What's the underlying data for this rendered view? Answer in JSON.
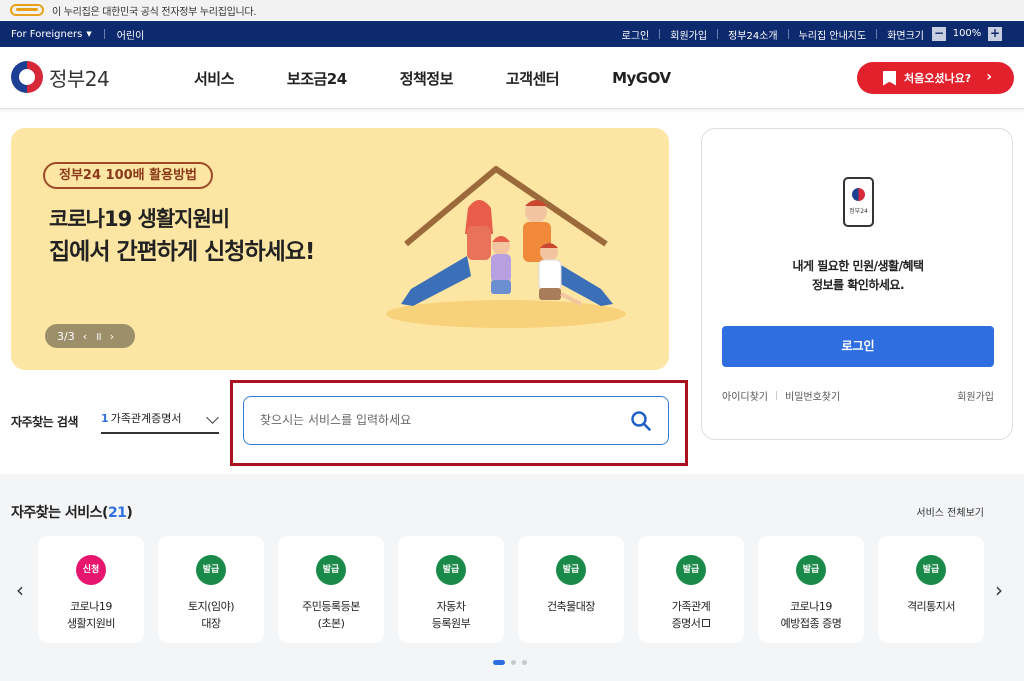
{
  "gov_banner": {
    "text": "이 누리집은 대한민국 공식 전자정부 누리집입니다."
  },
  "utility": {
    "foreigners": "For Foreigners",
    "kids": "어린이",
    "login": "로그인",
    "signup": "회원가입",
    "about": "정부24소개",
    "sitemap": "누리집 안내지도",
    "screen_size": "화면크기",
    "zoom_minus": "−",
    "zoom_value": "100%",
    "zoom_plus": "+"
  },
  "header": {
    "logo_text": "정부24",
    "nav": [
      "서비스",
      "보조금24",
      "정책정보",
      "고객센터",
      "MyGOV"
    ],
    "first_visit": "처음오셨나요?"
  },
  "hero": {
    "badge": "정부24 100배 활용방법",
    "line1": "코로나19 생활지원비",
    "line2": "집에서 간편하게 신청하세요!",
    "pager": "3/3"
  },
  "login_card": {
    "phone_text": "정부24",
    "message_line1": "내게 필요한 민원/생활/혜택",
    "message_line2": "정보를 확인하세요.",
    "login_button": "로그인",
    "find_id": "아이디찾기",
    "find_pw": "비밀번호찾기",
    "signup": "회원가입"
  },
  "search": {
    "frequent_label": "자주찾는 검색",
    "frequent_rank": "1",
    "frequent_value": "가족관계증명서",
    "placeholder": "찾으시는 서비스를 입력하세요"
  },
  "services": {
    "title": "자주찾는 서비스(",
    "count": "21",
    "title_end": ")",
    "view_all": "서비스 전체보기",
    "items": [
      {
        "badge": "신청",
        "line1": "코로나19",
        "line2": "생활지원비"
      },
      {
        "badge": "발급",
        "line1": "토지(임야)",
        "line2": "대장"
      },
      {
        "badge": "발급",
        "line1": "주민등록등본",
        "line2": "(초본)"
      },
      {
        "badge": "발급",
        "line1": "자동차",
        "line2": "등록원부"
      },
      {
        "badge": "발급",
        "line1": "건축물대장",
        "line2": ""
      },
      {
        "badge": "발급",
        "line1": "가족관계",
        "line2": "증명서"
      },
      {
        "badge": "발급",
        "line1": "코로나19",
        "line2": "예방접종 증명"
      },
      {
        "badge": "발급",
        "line1": "격리통지서",
        "line2": ""
      }
    ]
  },
  "colors": {
    "utility_bg": "#0d2a6e",
    "accent_red": "#e3212d",
    "primary_blue": "#2f6ee0",
    "badge_green": "#1a8a4a",
    "badge_pink": "#e6166e",
    "hero_bg": "#fde6a4",
    "highlight": "#a8121f"
  }
}
